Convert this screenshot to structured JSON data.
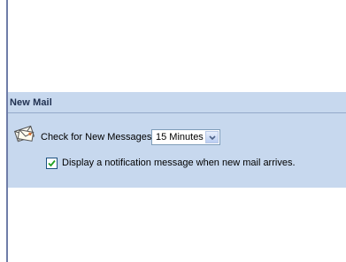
{
  "section": {
    "title": "New Mail"
  },
  "check_messages": {
    "label": "Check for New Messages:",
    "selected_interval": "15 Minutes"
  },
  "notification": {
    "label": "Display a notification message when new mail arrives.",
    "checked": true
  },
  "icons": {
    "mail": "mail-envelope-icon",
    "dropdown": "chevron-down-icon",
    "check": "checkmark-icon"
  },
  "colors": {
    "section_background": "#c7d8ee",
    "left_border": "#6f7da8",
    "checkmark": "#21a121"
  }
}
